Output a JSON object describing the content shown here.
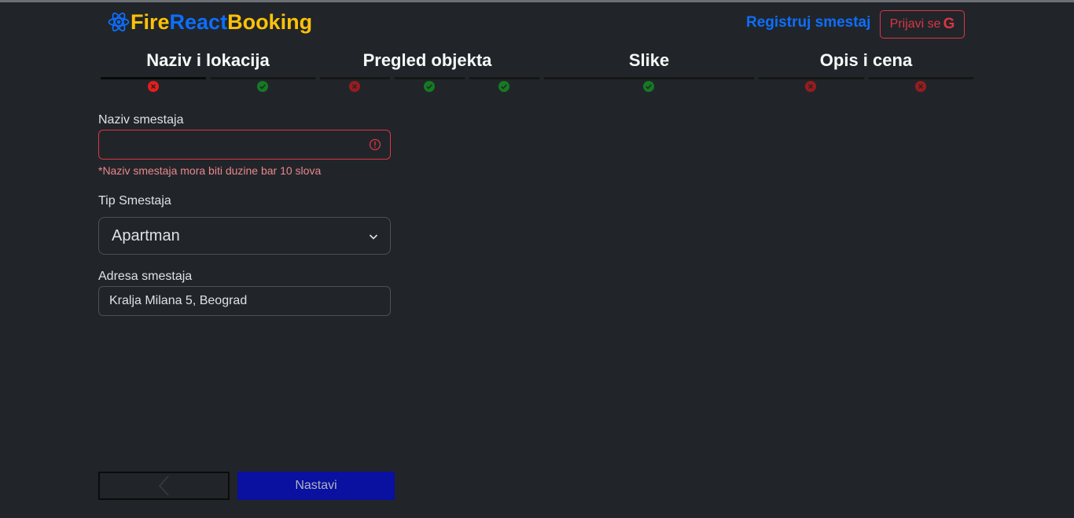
{
  "brand": {
    "part1": "Fire",
    "part2": "React",
    "part3": "Booking"
  },
  "header": {
    "register_label": "Registruj smestaj",
    "login_label": "Prijavi se",
    "login_icon": "G"
  },
  "steps": [
    {
      "title": "Naziv i lokacija"
    },
    {
      "title": "Pregled objekta"
    },
    {
      "title": "Slike"
    },
    {
      "title": "Opis i cena"
    }
  ],
  "substep_status": [
    "error",
    "ok",
    "error",
    "ok",
    "ok",
    "ok",
    "error",
    "error"
  ],
  "form": {
    "name_label": "Naziv smestaja",
    "name_value": "",
    "name_error": "*Naziv smestaja mora biti duzine bar 10 slova",
    "type_label": "Tip Smestaja",
    "type_value": "Apartman",
    "address_label": "Adresa smestaja",
    "address_value": "Kralja Milana 5, Beograd"
  },
  "footer": {
    "next_label": "Nastavi"
  },
  "colors": {
    "background": "#212529",
    "brand_yellow": "#ffc107",
    "brand_blue": "#0d6efd",
    "danger": "#dc3545",
    "ok_green": "#198754",
    "next_button": "#0a10a0"
  }
}
